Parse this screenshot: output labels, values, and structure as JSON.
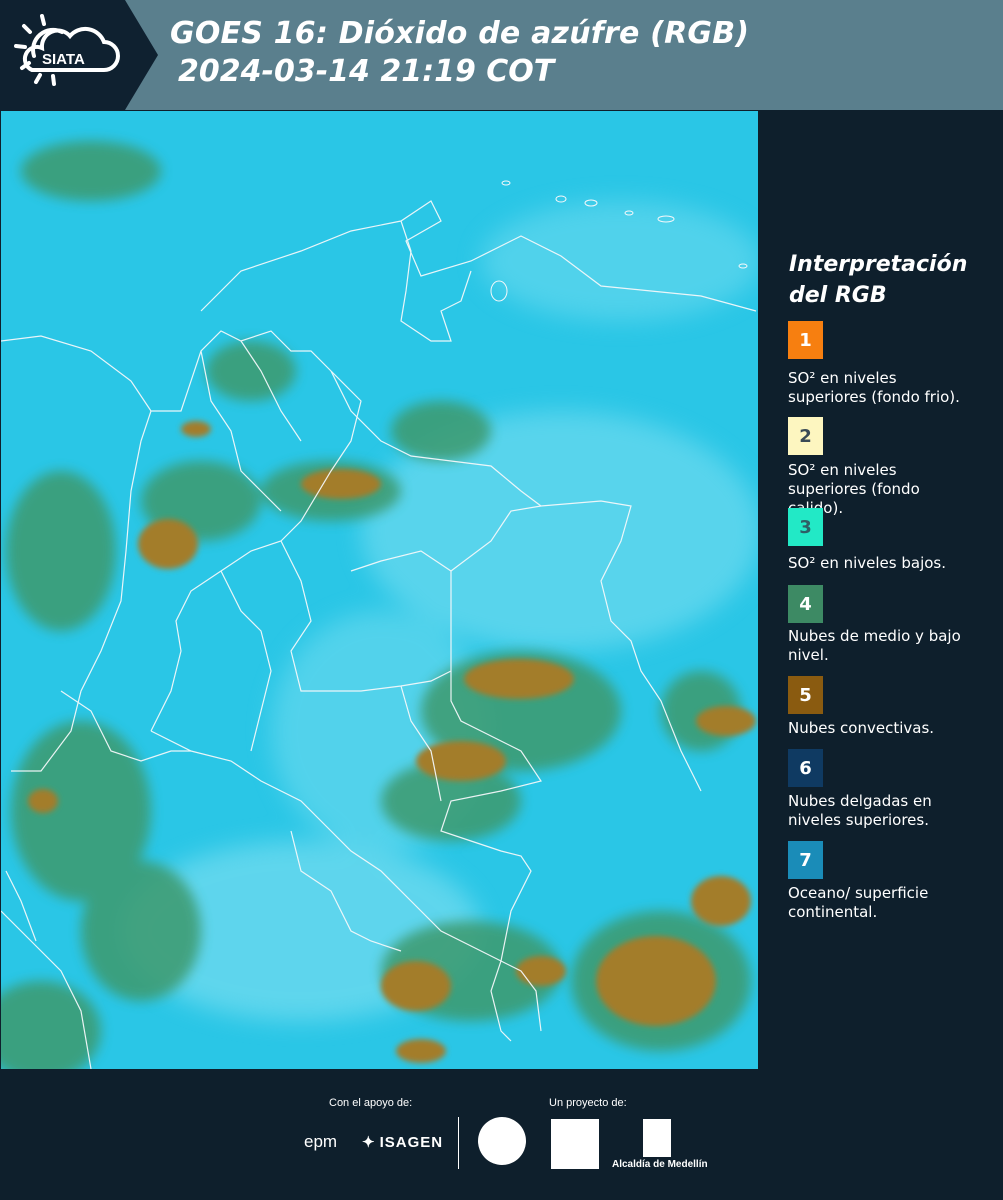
{
  "header": {
    "logo_text": "SIATA",
    "title": "GOES 16: Dióxido de azúfre (RGB)",
    "datetime": "2024-03-14 21:19 COT"
  },
  "legend": {
    "title": "Interpretación del RGB",
    "items": [
      {
        "number": "1",
        "color": "#f77f10",
        "number_color": "#ffffff",
        "text": "SO² en niveles superiores (fondo frio)."
      },
      {
        "number": "2",
        "color": "#fdf6c0",
        "number_color": "#3a4a56",
        "text": "SO² en niveles superiores (fondo calido)."
      },
      {
        "number": "3",
        "color": "#22e9c6",
        "number_color": "#2e5f66",
        "text": "SO² en niveles bajos."
      },
      {
        "number": "4",
        "color": "#3d8a64",
        "number_color": "#ffffff",
        "text": "Nubes de medio y bajo nivel."
      },
      {
        "number": "5",
        "color": "#8a5b10",
        "number_color": "#ffffff",
        "text": "Nubes convectivas."
      },
      {
        "number": "6",
        "color": "#0f3a62",
        "number_color": "#ffffff",
        "text": "Nubes delgadas en niveles superiores."
      },
      {
        "number": "7",
        "color": "#1a8cb8",
        "number_color": "#ffffff",
        "text": "Oceano/ superficie continental."
      }
    ]
  },
  "footer": {
    "support_label": "Con el apoyo de:",
    "project_label": "Un proyecto de:",
    "epm": "epm",
    "isagen": "ISAGEN",
    "alcaldia": "Alcaldía de Medellín"
  },
  "colors": {
    "background": "#0e1f2c",
    "header_band": "#5a7f8d",
    "map_base": "#27c4e4",
    "map_low_cloud": "#3d8a64",
    "map_convective": "#9b7a2a"
  }
}
